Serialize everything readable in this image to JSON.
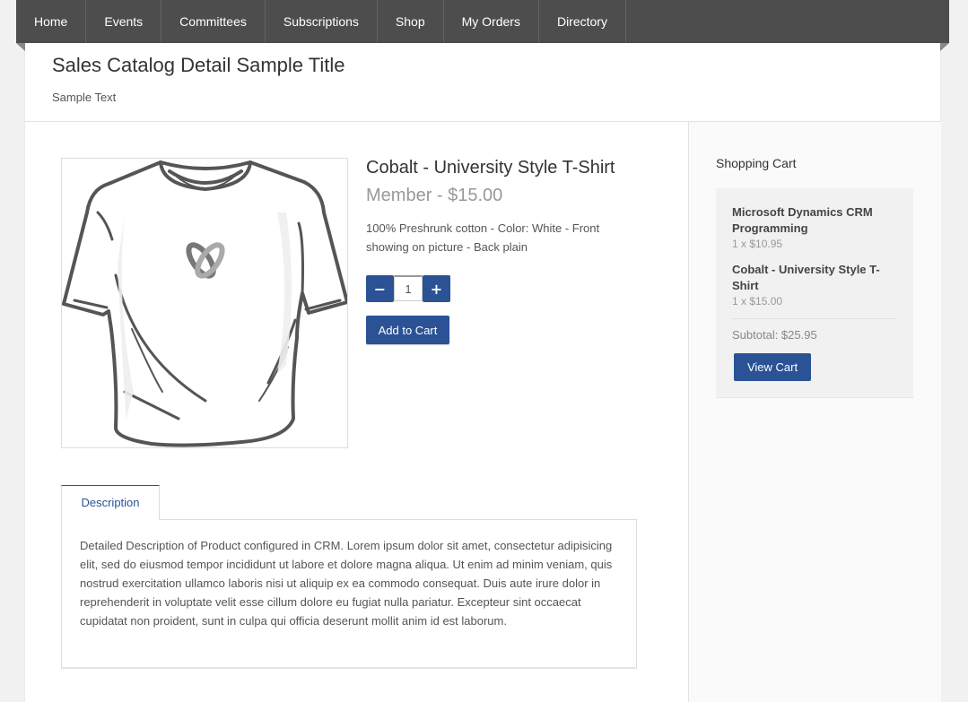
{
  "nav": {
    "items": [
      "Home",
      "Events",
      "Committees",
      "Subscriptions",
      "Shop",
      "My Orders",
      "Directory"
    ]
  },
  "header": {
    "title": "Sales Catalog Detail Sample Title",
    "subtitle": "Sample Text"
  },
  "product": {
    "image_alt": "t-shirt-image",
    "name": "Cobalt - University Style T-Shirt",
    "price": "Member - $15.00",
    "description": "100% Preshrunk cotton - Color: White - Front showing on picture - Back plain",
    "quantity": "1",
    "decrement_label": "−",
    "increment_label": "+",
    "add_to_cart_label": "Add to Cart"
  },
  "tabs": {
    "items": [
      {
        "label": "Description"
      }
    ],
    "active": "Description",
    "description_text": "Detailed Description of Product configured in CRM. Lorem ipsum dolor sit amet, consectetur adipisicing elit, sed do eiusmod tempor incididunt ut labore et dolore magna aliqua. Ut enim ad minim veniam, quis nostrud exercitation ullamco laboris nisi ut aliquip ex ea commodo consequat. Duis aute irure dolor in reprehenderit in voluptate velit esse cillum dolore eu fugiat nulla pariatur. Excepteur sint occaecat cupidatat non proident, sunt in culpa qui officia deserunt mollit anim id est laborum."
  },
  "cart": {
    "title": "Shopping Cart",
    "items": [
      {
        "name": "Microsoft Dynamics CRM Programming",
        "qty_price": "1 x $10.95"
      },
      {
        "name": "Cobalt - University Style T-Shirt",
        "qty_price": "1 x $15.00"
      }
    ],
    "subtotal": "Subtotal: $25.95",
    "view_cart_label": "View Cart"
  },
  "colors": {
    "nav_bg": "#4d4d4d",
    "accent": "#2a5295",
    "page_bg": "#f1f1f1"
  }
}
